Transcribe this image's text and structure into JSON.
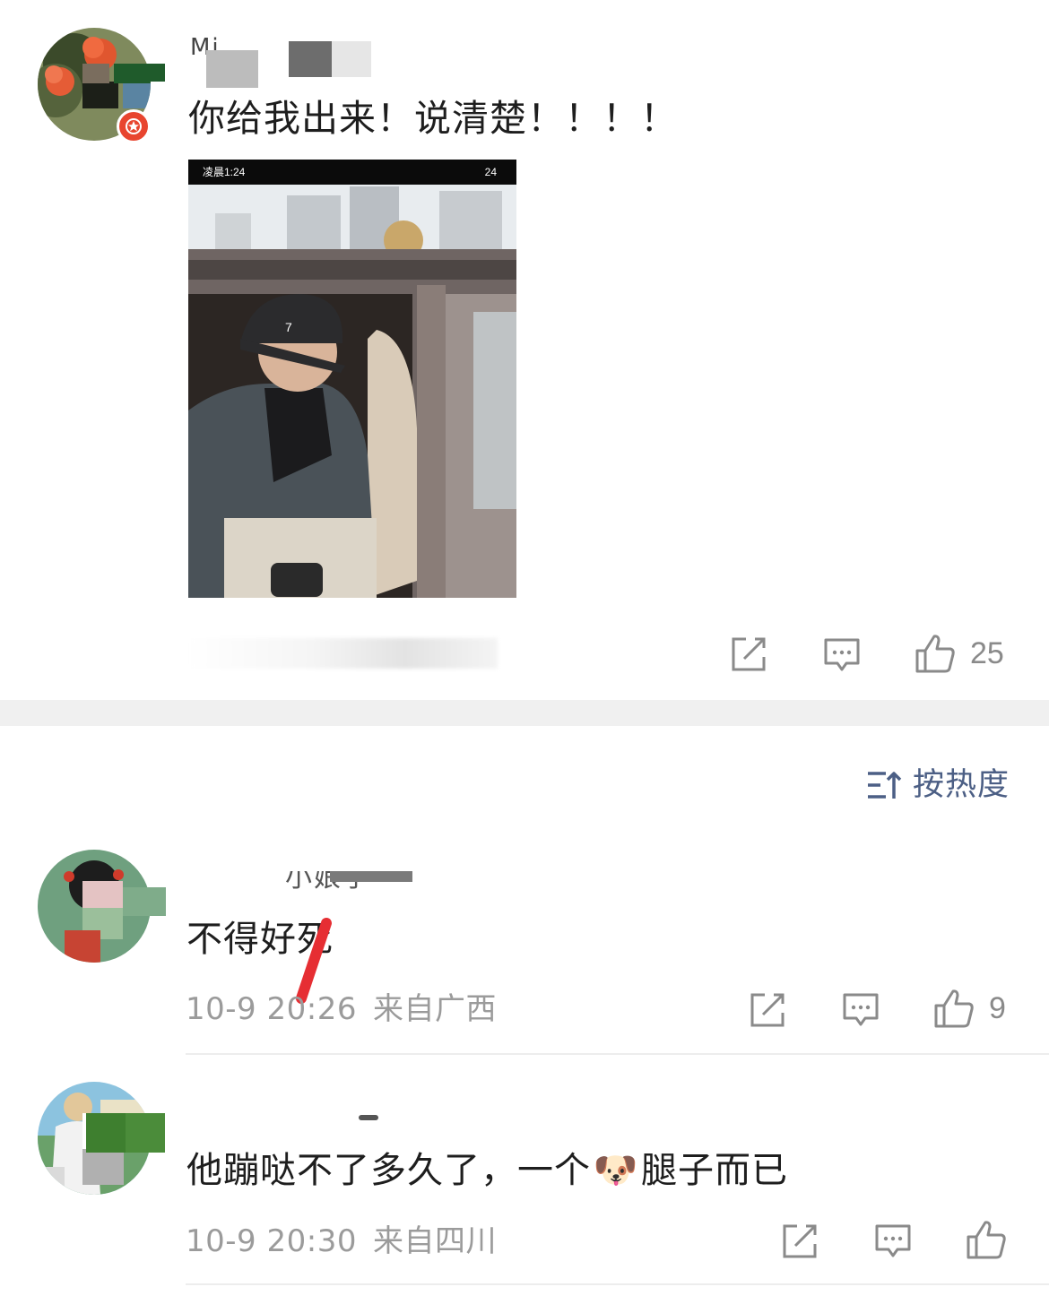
{
  "post": {
    "author_name": "Mi",
    "text": "你给我出来！说清楚！！！！",
    "photo": {
      "status_time": "凌晨1:24",
      "battery": "24"
    },
    "like_count": "25"
  },
  "sort": {
    "label": "按热度"
  },
  "comments": [
    {
      "author_name": "小娘子",
      "text": "不得好死",
      "date": "10-9 20:26",
      "location": "来自广西",
      "like_count": "9"
    },
    {
      "author_name": "",
      "text_before": "他蹦哒不了多久了，一个",
      "emoji": "🐶",
      "text_after": "腿子而已",
      "date": "10-9 20:30",
      "location": "来自四川",
      "like_count": ""
    }
  ],
  "icons": {
    "share": "share-icon",
    "comment": "comment-icon",
    "like": "thumbs-up-icon",
    "sort": "sort-icon"
  },
  "colors": {
    "badge": "#e8452f",
    "sort_text": "#4c5f85",
    "meta_text": "#9b9b9b",
    "icon_gray": "#8a8a8a",
    "separator": "#f0f0f0"
  }
}
